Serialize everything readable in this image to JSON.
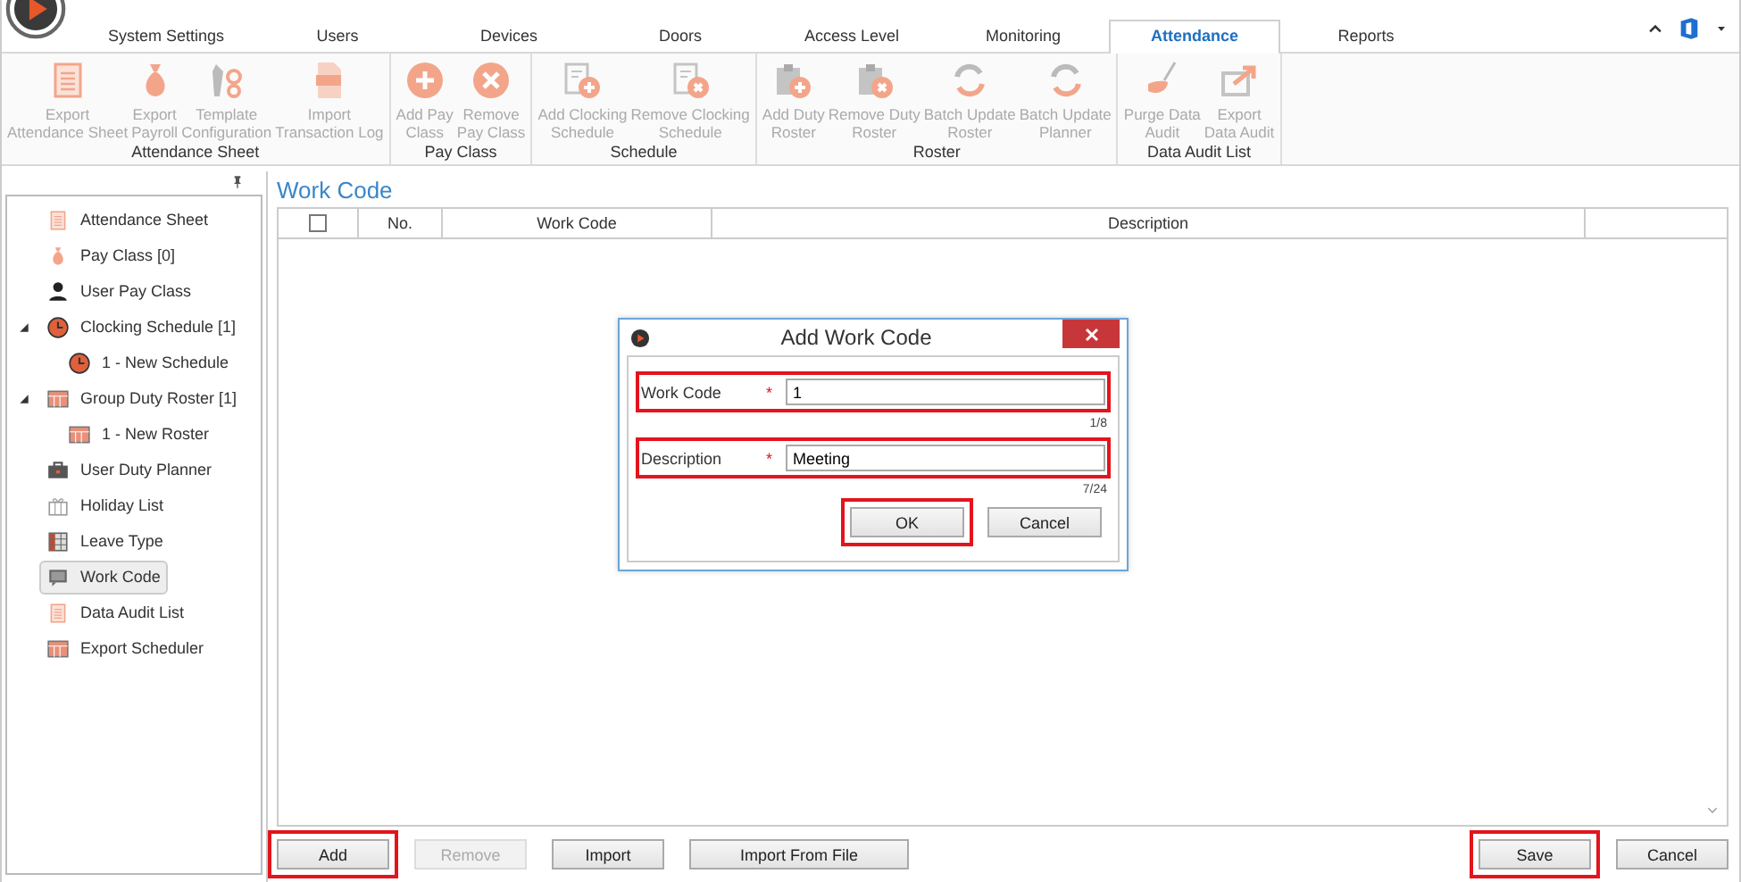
{
  "tabs": [
    {
      "label": "System Settings",
      "selected": false
    },
    {
      "label": "Users",
      "selected": false
    },
    {
      "label": "Devices",
      "selected": false
    },
    {
      "label": "Doors",
      "selected": false
    },
    {
      "label": "Access Level",
      "selected": false
    },
    {
      "label": "Monitoring",
      "selected": false
    },
    {
      "label": "Attendance",
      "selected": true
    },
    {
      "label": "Reports",
      "selected": false
    }
  ],
  "ribbon": [
    {
      "title": "Attendance Sheet",
      "buttons": [
        {
          "kind": "sheet",
          "label": "Export\nAttendance Sheet"
        },
        {
          "kind": "bag",
          "label": "Export\nPayroll"
        },
        {
          "kind": "tools",
          "label": "Template\nConfiguration"
        },
        {
          "kind": "log",
          "label": "Import\nTransaction Log"
        }
      ]
    },
    {
      "title": "Pay Class",
      "buttons": [
        {
          "kind": "plus",
          "label": "Add Pay\nClass"
        },
        {
          "kind": "cross",
          "label": "Remove\nPay Class"
        }
      ]
    },
    {
      "title": "Schedule",
      "buttons": [
        {
          "kind": "docplus",
          "label": "Add Clocking\nSchedule"
        },
        {
          "kind": "docx",
          "label": "Remove Clocking\nSchedule"
        }
      ]
    },
    {
      "title": "Roster",
      "buttons": [
        {
          "kind": "clipplus",
          "label": "Add Duty\nRoster"
        },
        {
          "kind": "clipx",
          "label": "Remove Duty\nRoster"
        },
        {
          "kind": "sync",
          "label": "Batch Update\nRoster"
        },
        {
          "kind": "sync",
          "label": "Batch Update\nPlanner"
        }
      ]
    },
    {
      "title": "Data Audit List",
      "buttons": [
        {
          "kind": "broom",
          "label": "Purge Data\nAudit"
        },
        {
          "kind": "export",
          "label": "Export\nData Audit"
        }
      ]
    }
  ],
  "sidebar": {
    "items": [
      {
        "kind": "sheet",
        "label": "Attendance Sheet",
        "selected": false
      },
      {
        "kind": "bag",
        "label": "Pay Class [0]",
        "selected": false
      },
      {
        "kind": "person",
        "label": "User Pay Class",
        "selected": false
      },
      {
        "kind": "clock",
        "label": "Clocking Schedule [1]",
        "selected": false,
        "expanded": true,
        "children": [
          {
            "kind": "clock",
            "label": "1 - New Schedule",
            "selected": false
          }
        ]
      },
      {
        "kind": "grid",
        "label": "Group Duty Roster [1]",
        "selected": false,
        "expanded": true,
        "children": [
          {
            "kind": "grid",
            "label": "1 - New Roster",
            "selected": false
          }
        ]
      },
      {
        "kind": "briefcase",
        "label": "User Duty Planner",
        "selected": false
      },
      {
        "kind": "gift",
        "label": "Holiday List",
        "selected": false
      },
      {
        "kind": "table",
        "label": "Leave Type",
        "selected": false
      },
      {
        "kind": "chat",
        "label": "Work Code",
        "selected": true
      },
      {
        "kind": "sheet",
        "label": "Data Audit List",
        "selected": false
      },
      {
        "kind": "grid",
        "label": "Export Scheduler",
        "selected": false
      }
    ]
  },
  "panel": {
    "title": "Work Code",
    "table": {
      "select_all": {
        "checked": false
      },
      "columns": [
        "No.",
        "Work Code",
        "Description"
      ]
    },
    "buttons_left": [
      {
        "label": "Add",
        "disabled": false,
        "highlighted": true
      },
      {
        "label": "Remove",
        "disabled": true,
        "highlighted": false
      },
      {
        "label": "Import",
        "disabled": false,
        "highlighted": false
      },
      {
        "label": "Import From File",
        "disabled": false,
        "highlighted": false
      }
    ],
    "buttons_right": [
      {
        "label": "Save",
        "disabled": false,
        "highlighted": true
      },
      {
        "label": "Cancel",
        "disabled": false,
        "highlighted": false
      }
    ]
  },
  "dialog": {
    "title": "Add Work Code",
    "fields": [
      {
        "label": "Work Code",
        "required_mark": "*",
        "value": "1",
        "counter": "1/8",
        "highlighted": true
      },
      {
        "label": "Description",
        "required_mark": "*",
        "value": "Meeting",
        "counter": "7/24",
        "highlighted": true
      }
    ],
    "buttons": [
      {
        "label": "OK",
        "highlighted": true
      },
      {
        "label": "Cancel",
        "highlighted": false
      }
    ]
  }
}
